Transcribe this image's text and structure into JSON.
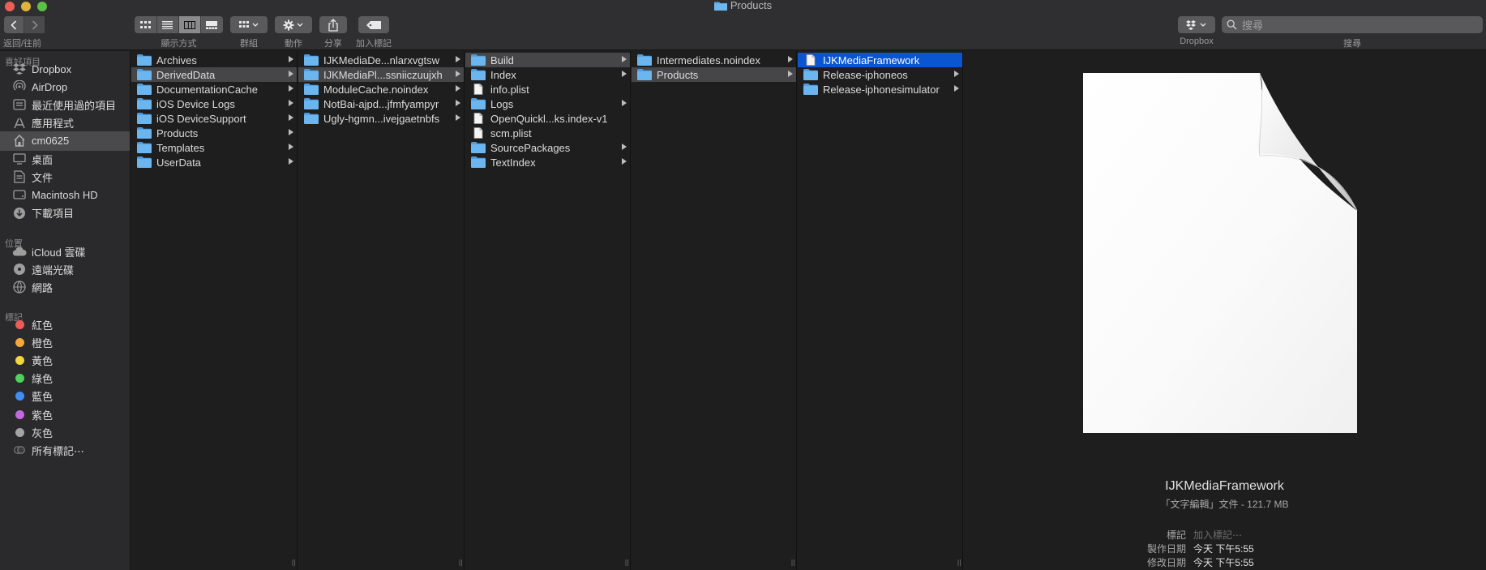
{
  "window": {
    "title": "Products"
  },
  "toolbar": {
    "nav_label": "返回/往前",
    "view_label": "顯示方式",
    "group_label": "群組",
    "action_label": "動作",
    "share_label": "分享",
    "tags_label": "加入標記",
    "dropbox_label": "Dropbox",
    "search_label": "搜尋",
    "search_placeholder": "搜尋"
  },
  "sidebar": {
    "favorites_header": "喜好項目",
    "favorites": [
      {
        "label": "Dropbox",
        "icon": "dropbox-icon"
      },
      {
        "label": "AirDrop",
        "icon": "airdrop-icon"
      },
      {
        "label": "最近使用過的項目",
        "icon": "recents-icon"
      },
      {
        "label": "應用程式",
        "icon": "applications-icon"
      },
      {
        "label": "cm0625",
        "icon": "home-icon",
        "active": true
      },
      {
        "label": "桌面",
        "icon": "desktop-icon"
      },
      {
        "label": "文件",
        "icon": "documents-icon"
      },
      {
        "label": "Macintosh HD",
        "icon": "disk-icon"
      },
      {
        "label": "下載項目",
        "icon": "downloads-icon"
      }
    ],
    "locations_header": "位置",
    "locations": [
      {
        "label": "iCloud 雲碟",
        "icon": "cloud-icon"
      },
      {
        "label": "遠端光碟",
        "icon": "disc-icon"
      },
      {
        "label": "網路",
        "icon": "network-icon"
      }
    ],
    "tags_header": "標記",
    "tags": [
      {
        "label": "紅色",
        "color": "#ef5a56"
      },
      {
        "label": "橙色",
        "color": "#f4a93b"
      },
      {
        "label": "黃色",
        "color": "#f2d63b"
      },
      {
        "label": "綠色",
        "color": "#4fd15a"
      },
      {
        "label": "藍色",
        "color": "#3f8ef5"
      },
      {
        "label": "紫色",
        "color": "#c468e0"
      },
      {
        "label": "灰色",
        "color": "#a4a4a6"
      },
      {
        "label": "所有標記⋯",
        "color": "all"
      }
    ]
  },
  "columns": [
    [
      {
        "name": "Archives",
        "type": "folder",
        "arrow": true
      },
      {
        "name": "DerivedData",
        "type": "folder",
        "arrow": true,
        "selected": "inactive"
      },
      {
        "name": "DocumentationCache",
        "type": "folder",
        "arrow": true
      },
      {
        "name": "iOS Device Logs",
        "type": "folder",
        "arrow": true
      },
      {
        "name": "iOS DeviceSupport",
        "type": "folder",
        "arrow": true
      },
      {
        "name": "Products",
        "type": "folder",
        "arrow": true
      },
      {
        "name": "Templates",
        "type": "folder",
        "arrow": true
      },
      {
        "name": "UserData",
        "type": "folder",
        "arrow": true
      }
    ],
    [
      {
        "name": "IJKMediaDe...nlarxvgtsw",
        "type": "folder",
        "arrow": true
      },
      {
        "name": "IJKMediaPl...ssniiczuujxh",
        "type": "folder",
        "arrow": true,
        "selected": "inactive"
      },
      {
        "name": "ModuleCache.noindex",
        "type": "folder",
        "arrow": true
      },
      {
        "name": "NotBai-ajpd...jfmfyampyr",
        "type": "folder",
        "arrow": true
      },
      {
        "name": "Ugly-hgmn...ivejgaetnbfs",
        "type": "folder",
        "arrow": true
      }
    ],
    [
      {
        "name": "Build",
        "type": "folder",
        "arrow": true,
        "selected": "inactive"
      },
      {
        "name": "Index",
        "type": "folder",
        "arrow": true
      },
      {
        "name": "info.plist",
        "type": "file",
        "arrow": false
      },
      {
        "name": "Logs",
        "type": "folder",
        "arrow": true
      },
      {
        "name": "OpenQuickl...ks.index-v1",
        "type": "file",
        "arrow": false
      },
      {
        "name": "scm.plist",
        "type": "file",
        "arrow": false
      },
      {
        "name": "SourcePackages",
        "type": "folder",
        "arrow": true
      },
      {
        "name": "TextIndex",
        "type": "folder",
        "arrow": true
      }
    ],
    [
      {
        "name": "Intermediates.noindex",
        "type": "folder",
        "arrow": true
      },
      {
        "name": "Products",
        "type": "folder",
        "arrow": true,
        "selected": "inactive"
      }
    ],
    [
      {
        "name": "IJKMediaFramework",
        "type": "file",
        "arrow": false,
        "selected": "active"
      },
      {
        "name": "Release-iphoneos",
        "type": "folder",
        "arrow": true
      },
      {
        "name": "Release-iphonesimulator",
        "type": "folder",
        "arrow": true
      }
    ]
  ],
  "preview": {
    "name": "IJKMediaFramework",
    "kind": "「文字編輯」文件 - 121.7 MB",
    "tags_label": "標記",
    "tags_placeholder": "加入標記⋯",
    "created_label": "製作日期",
    "created_value": "今天 下午5:55",
    "modified_label": "修改日期",
    "modified_value": "今天 下午5:55"
  }
}
